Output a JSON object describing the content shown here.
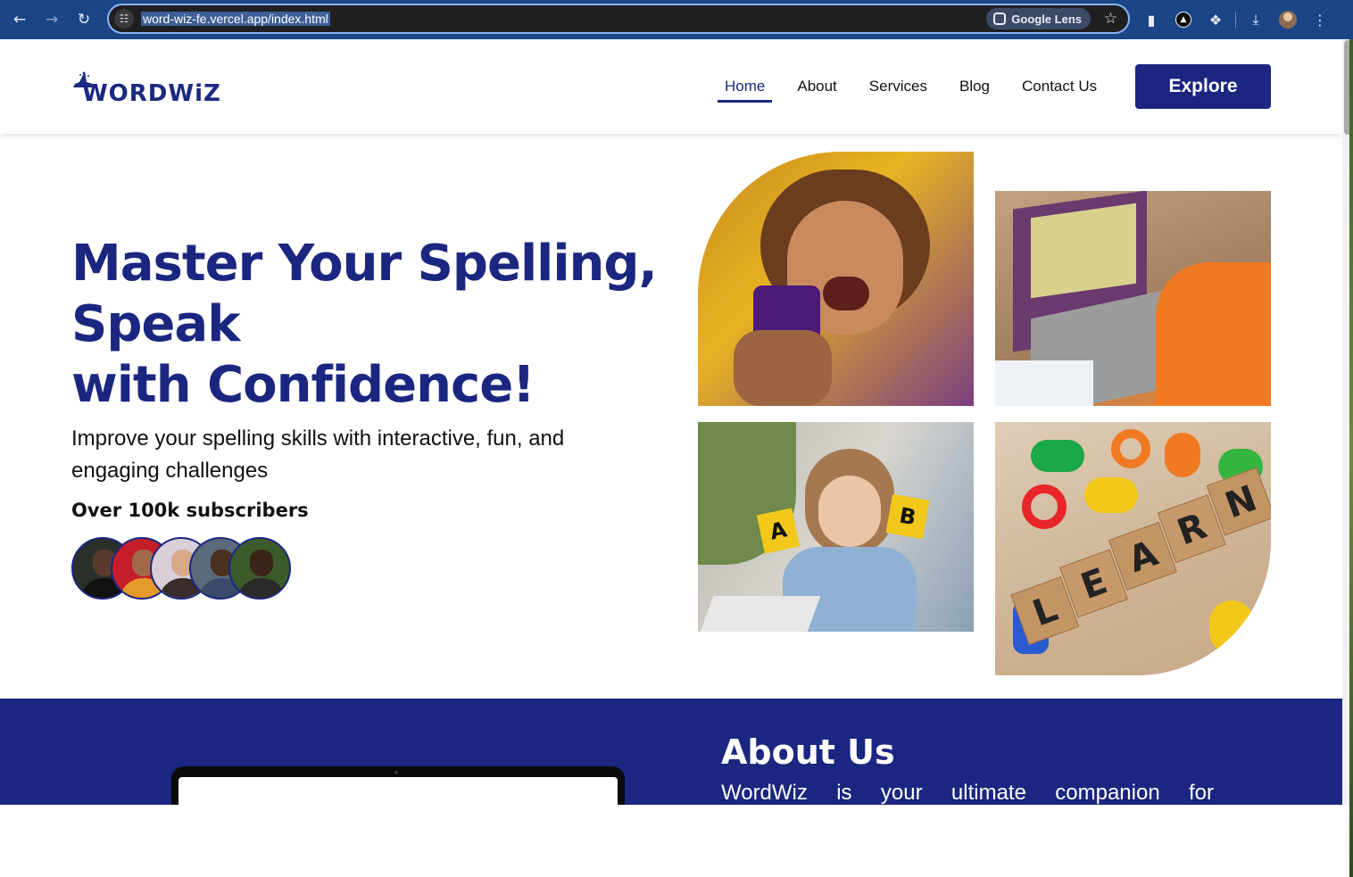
{
  "browser": {
    "url": "word-wiz-fe.vercel.app/index.html",
    "lens_label": "Google Lens"
  },
  "header": {
    "logo_text": "WORDWiZ",
    "nav": [
      {
        "label": "Home"
      },
      {
        "label": "About"
      },
      {
        "label": "Services"
      },
      {
        "label": "Blog"
      },
      {
        "label": "Contact Us"
      }
    ],
    "cta_label": "Explore"
  },
  "hero": {
    "title_lines": [
      "Master Your Spelling,",
      "Speak",
      "with Confidence!"
    ],
    "subtitle": "Improve your spelling skills with interactive, fun, and engaging challenges",
    "subscribers": "Over 100k subscribers"
  },
  "gallery": {
    "block_letters": [
      "L",
      "E",
      "A",
      "R",
      "N"
    ],
    "cards": [
      "A",
      "B"
    ]
  },
  "about": {
    "title": "About Us",
    "text": "WordWiz is your ultimate companion for"
  },
  "colors": {
    "brand": "#1b2680",
    "chrome": "#1c4587"
  }
}
